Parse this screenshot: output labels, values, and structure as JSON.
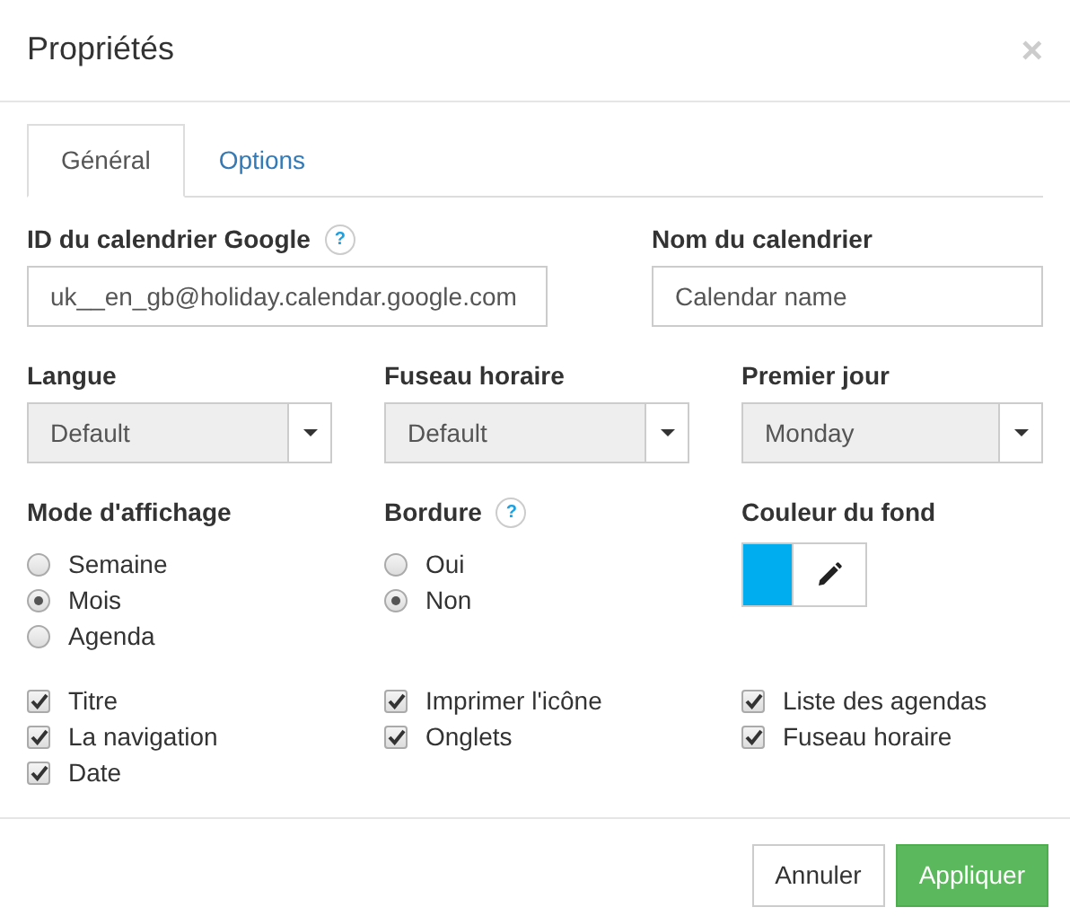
{
  "dialog": {
    "title": "Propriétés",
    "close": "×"
  },
  "tabs": [
    {
      "label": "Général",
      "selected": true
    },
    {
      "label": "Options",
      "selected": false
    }
  ],
  "text_fields": [
    {
      "label": "ID du calendrier Google",
      "help": "?",
      "value": "uk__en_gb@holiday.calendar.google.com"
    },
    {
      "label": "Nom du calendrier",
      "placeholder": "Calendar name"
    }
  ],
  "selects": [
    {
      "label": "Langue",
      "value": "Default"
    },
    {
      "label": "Fuseau horaire",
      "value": "Default"
    },
    {
      "label": "Premier jour",
      "value": "Monday"
    }
  ],
  "radio_groups": [
    {
      "label": "Mode d'affichage",
      "options": [
        {
          "label": "Semaine",
          "selected": false
        },
        {
          "label": "Mois",
          "selected": true
        },
        {
          "label": "Agenda",
          "selected": false
        }
      ]
    },
    {
      "label": "Bordure",
      "help": "?",
      "options": [
        {
          "label": "Oui",
          "selected": false
        },
        {
          "label": "Non",
          "selected": true
        }
      ]
    }
  ],
  "background_color": {
    "label": "Couleur du fond",
    "color": "#00aeef"
  },
  "checkbox_columns": [
    [
      {
        "label": "Titre",
        "checked": true
      },
      {
        "label": "La navigation",
        "checked": true
      },
      {
        "label": "Date",
        "checked": true
      }
    ],
    [
      {
        "label": "Imprimer l'icône",
        "checked": true
      },
      {
        "label": "Onglets",
        "checked": true
      }
    ],
    [
      {
        "label": "Liste des agendas",
        "checked": true
      },
      {
        "label": "Fuseau horaire",
        "checked": true
      }
    ]
  ],
  "buttons": [
    {
      "label": "Annuler",
      "kind": "default"
    },
    {
      "label": "Appliquer",
      "kind": "primary"
    }
  ]
}
